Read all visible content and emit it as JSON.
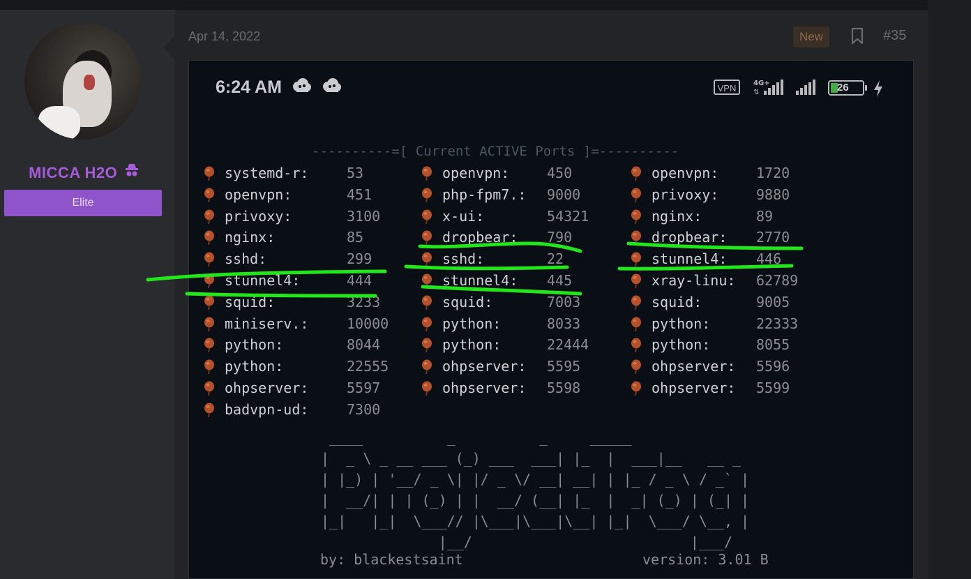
{
  "post": {
    "date": "Apr 14, 2022",
    "new_label": "New",
    "post_number": "#35"
  },
  "user": {
    "name": "MICCA H2O",
    "rank": "Elite",
    "accent_color": "#a65bd8"
  },
  "status_bar": {
    "time": "6:24 AM",
    "vpn_label": "VPN",
    "network_label": "4G+",
    "battery_level": "26"
  },
  "terminal": {
    "header": "----------=[ Current ACTIVE Ports ]=----------",
    "columns": [
      [
        {
          "name": "systemd-r:",
          "port": "53"
        },
        {
          "name": "openvpn:",
          "port": "451"
        },
        {
          "name": "privoxy:",
          "port": "3100"
        },
        {
          "name": "nginx:",
          "port": "85"
        },
        {
          "name": "sshd:",
          "port": "299"
        },
        {
          "name": "stunnel4:",
          "port": "444"
        },
        {
          "name": "squid:",
          "port": "3233"
        },
        {
          "name": "miniserv.:",
          "port": "10000"
        },
        {
          "name": "python:",
          "port": "8044"
        },
        {
          "name": "python:",
          "port": "22555"
        },
        {
          "name": "ohpserver:",
          "port": "5597"
        },
        {
          "name": "badvpn-ud:",
          "port": "7300"
        }
      ],
      [
        {
          "name": "openvpn:",
          "port": "450"
        },
        {
          "name": "php-fpm7.:",
          "port": "9000"
        },
        {
          "name": "x-ui:",
          "port": "54321"
        },
        {
          "name": "dropbear:",
          "port": "790"
        },
        {
          "name": "sshd:",
          "port": "22"
        },
        {
          "name": "stunnel4:",
          "port": "445"
        },
        {
          "name": "squid:",
          "port": "7003"
        },
        {
          "name": "python:",
          "port": "8033"
        },
        {
          "name": "python:",
          "port": "22444"
        },
        {
          "name": "ohpserver:",
          "port": "5595"
        },
        {
          "name": "ohpserver:",
          "port": "5598"
        }
      ],
      [
        {
          "name": "openvpn:",
          "port": "1720"
        },
        {
          "name": "privoxy:",
          "port": "9880"
        },
        {
          "name": "nginx:",
          "port": "89"
        },
        {
          "name": "dropbear:",
          "port": "2770"
        },
        {
          "name": "stunnel4:",
          "port": "446"
        },
        {
          "name": "xray-linu:",
          "port": "62789"
        },
        {
          "name": "squid:",
          "port": "9005"
        },
        {
          "name": "python:",
          "port": "22333"
        },
        {
          "name": "python:",
          "port": "8055"
        },
        {
          "name": "ohpserver:",
          "port": "5596"
        },
        {
          "name": "ohpserver:",
          "port": "5599"
        }
      ]
    ],
    "ascii_art": [
      " ____          _          _     _____",
      "|  _ \\ _ __ ___ (_) ___  ___| |_  |  ___|__   __ _",
      "| |_) | '__/ _ \\| |/ _ \\/ __| __| | |_ / _ \\ / _` |",
      "|  __/| | | (_) | |  __/ (__| |_  |  _| (_) | (_| |",
      "|_|   |_|  \\___// |\\___|\\___|\\__| |_|  \\___/ \\__, |",
      "              |__/                          |___/"
    ],
    "author": "by: blackestsaint",
    "version": "version: 3.01 B"
  }
}
